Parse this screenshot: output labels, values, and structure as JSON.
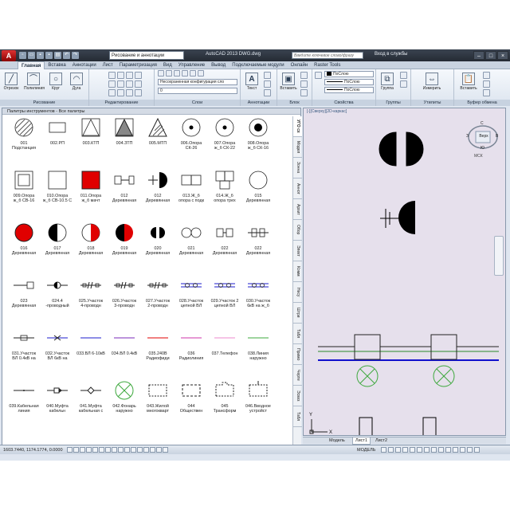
{
  "title_bar": {
    "app_logo": "A",
    "workspace": "Рисование и аннотации",
    "title": "AutoCAD 2013    DWG.dwg",
    "search_placeholder": "Введите ключевое слово/фразу",
    "sign_in": "Вход в службы",
    "qat_icons": [
      "new-icon",
      "open-icon",
      "save-icon",
      "saveas-icon",
      "print-icon",
      "undo-icon",
      "redo-icon"
    ]
  },
  "ribbon_tabs": [
    "Главная",
    "Вставка",
    "Аннотации",
    "Лист",
    "Параметризация",
    "Вид",
    "Управление",
    "Вывод",
    "Подключаемые модули",
    "Онлайн",
    "Raster Tools"
  ],
  "active_tab": "Главная",
  "panels": {
    "draw": {
      "label": "Рисование",
      "buttons": [
        "Отрезок",
        "Полилиния",
        "Круг",
        "Дуга"
      ]
    },
    "modify": {
      "label": "Редактирование"
    },
    "layers": {
      "label": "Слои",
      "layer_state": "Несохраненная конфигурация сло",
      "current_layer": "0"
    },
    "annotation": {
      "label": "Аннотации",
      "buttons": [
        "Текст"
      ]
    },
    "block": {
      "label": "Блок",
      "buttons": [
        "Вставить"
      ]
    },
    "properties": {
      "label": "Свойства",
      "bylayer_1": "ПоСлою",
      "bylayer_2": "ПоСлою",
      "bylayer_3": "ПоСлою"
    },
    "groups": {
      "label": "Группы",
      "buttons": [
        "Группа"
      ]
    },
    "utilities": {
      "label": "Утилиты",
      "buttons": [
        "Измерить"
      ]
    },
    "clipboard": {
      "label": "Буфер обмена",
      "buttons": [
        "Вставить"
      ]
    }
  },
  "palette": {
    "title": "Палитры инструментов - Все палитры",
    "items": [
      {
        "label1": "001",
        "label2": "Подстанция",
        "symbol": "hatched-circle"
      },
      {
        "label1": "002.РП",
        "label2": "",
        "symbol": "rect"
      },
      {
        "label1": "003.КТП",
        "label2": "",
        "symbol": "rect-triangle"
      },
      {
        "label1": "004.ЗТП",
        "label2": "",
        "symbol": "rect-hatched-triangle"
      },
      {
        "label1": "005.МТП",
        "label2": "",
        "symbol": "hatched-triangle"
      },
      {
        "label1": "006.Опора",
        "label2": "СК-26",
        "symbol": "circle-dot"
      },
      {
        "label1": "007.Опора",
        "label2": "ж_б СК-22",
        "symbol": "circle-dot"
      },
      {
        "label1": "008.Опора",
        "label2": "ж_б СК-16",
        "symbol": "circle-bigdot"
      },
      {
        "label1": "009.Опора",
        "label2": "ж_б СВ-16",
        "symbol": "double-square"
      },
      {
        "label1": "010.Опора",
        "label2": "ж_б СВ-10.5 С",
        "symbol": "square"
      },
      {
        "label1": "011.Опора",
        "label2": "ж_б мачт",
        "symbol": "red-square"
      },
      {
        "label1": "012",
        "label2": "Деревянная",
        "symbol": "rect-line"
      },
      {
        "label1": "012",
        "label2": "Деревянная",
        "symbol": "line-halfcircle"
      },
      {
        "label1": "013.Ж_б",
        "label2": "опора с подк",
        "symbol": "double-rect"
      },
      {
        "label1": "014.Ж_б",
        "label2": "опора трех",
        "symbol": "triple-rect"
      },
      {
        "label1": "015",
        "label2": "Деревянная",
        "symbol": "circle"
      },
      {
        "label1": "016",
        "label2": "Деревянная",
        "symbol": "red-circle"
      },
      {
        "label1": "017",
        "label2": "Деревянная",
        "symbol": "half-black-circle"
      },
      {
        "label1": "018",
        "label2": "Деревянная",
        "symbol": "half-red-circle"
      },
      {
        "label1": "019",
        "label2": "Деревянная",
        "symbol": "black-red-circle"
      },
      {
        "label1": "020",
        "label2": "Деревянная",
        "symbol": "two-half-circles"
      },
      {
        "label1": "021",
        "label2": "Деревянная",
        "symbol": "two-circles"
      },
      {
        "label1": "022",
        "label2": "Деревянная",
        "symbol": "two-rects"
      },
      {
        "label1": "022",
        "label2": "Деревянная",
        "symbol": "two-rects-lines"
      },
      {
        "label1": "023",
        "label2": "Деревянная",
        "symbol": "line-rect"
      },
      {
        "label1": "024.4",
        "label2": "-проводный",
        "symbol": "line-halfcircle-small"
      },
      {
        "label1": "025.Участок",
        "label2": "4-проводн",
        "symbol": "line-slashes"
      },
      {
        "label1": "026.Участок",
        "label2": "3-проводн",
        "symbol": "line-slashes"
      },
      {
        "label1": "027.Участок",
        "label2": "2-проводн",
        "symbol": "line-slashes"
      },
      {
        "label1": "028.Участок",
        "label2": "цепной ВЛ",
        "symbol": "blue-lines"
      },
      {
        "label1": "029.Участок 2",
        "label2": "цепной ВЛ",
        "symbol": "blue-lines"
      },
      {
        "label1": "030.Участок",
        "label2": "6кВ на ж_б",
        "symbol": "blue-lines"
      },
      {
        "label1": "031.Участок",
        "label2": "ВЛ 0.4кВ на",
        "symbol": "line-rect-small"
      },
      {
        "label1": "032.Участок",
        "label2": "ВЛ 6кВ на",
        "symbol": "blue-cross-lines"
      },
      {
        "label1": "033.ВЛ 6-10кВ",
        "label2": "",
        "symbol": "blue-line"
      },
      {
        "label1": "034.ВЛ 0.4кВ",
        "label2": "",
        "symbol": "purple-line"
      },
      {
        "label1": "035.240В",
        "label2": "Радиофиди",
        "symbol": "red-line"
      },
      {
        "label1": "036",
        "label2": "Радиолиния",
        "symbol": "magenta-line"
      },
      {
        "label1": "037.Телефон",
        "label2": "",
        "symbol": "pink-line"
      },
      {
        "label1": "038.Линия",
        "label2": "наружно",
        "symbol": "green-line"
      },
      {
        "label1": "039.Кабельная",
        "label2": "линия",
        "symbol": "cable-line"
      },
      {
        "label1": "040.Муфта",
        "label2": "кабельн",
        "symbol": "line-arrow-rect"
      },
      {
        "label1": "041.Муфта",
        "label2": "кабельная с",
        "symbol": "line-diamond"
      },
      {
        "label1": "042.Фонарь",
        "label2": "наружно",
        "symbol": "green-x-circle"
      },
      {
        "label1": "043.Жилой",
        "label2": "многокварт",
        "symbol": "dashed-rect"
      },
      {
        "label1": "044",
        "label2": "Обществен",
        "symbol": "dashed-rect-2"
      },
      {
        "label1": "045",
        "label2": "Трансформ",
        "symbol": "dashed-rect-notch"
      },
      {
        "label1": "046.Вводное",
        "label2": "устройст",
        "symbol": "dashed-rect-line"
      }
    ],
    "side_tabs": [
      "УГО сх",
      "Модел",
      "Зонна",
      "Аннот",
      "Архит",
      "Обор",
      "Элект",
      "Комм",
      "Несу",
      "Штри",
      "Табл",
      "Примо",
      "Черте",
      "Эскиз",
      "Табл"
    ]
  },
  "viewport": {
    "label": "[-][Сверху][2D-каркас]",
    "viewcube": {
      "top": "С",
      "face": "Верх",
      "bottom": "Ю",
      "left": "З",
      "right": "В",
      "wcs": "МСК"
    }
  },
  "layout_tabs": [
    "Модель",
    "Лист1",
    "Лист2"
  ],
  "status": {
    "coords": "1603.7440, 1174.1774, 0.0000",
    "model": "МОДЕЛЬ"
  },
  "colors": {
    "red": "#e00000",
    "blue": "#1c1ccc",
    "green": "#3da83d",
    "canvas_bg": "#e6e0ec",
    "title_bg": "#2d343e"
  }
}
